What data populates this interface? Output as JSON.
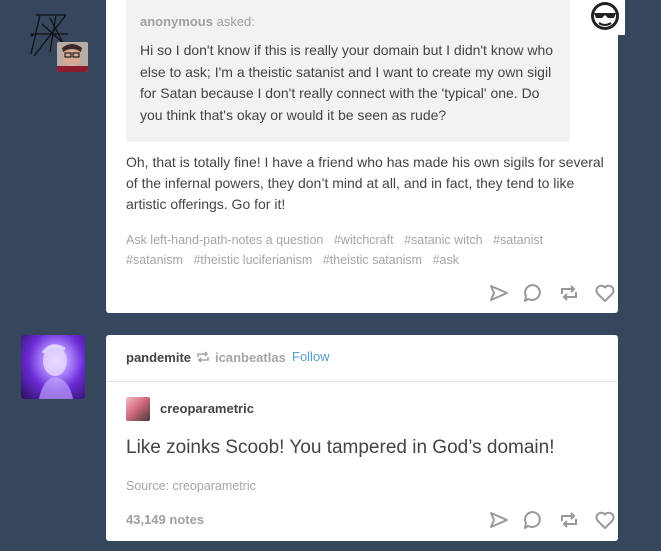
{
  "post1": {
    "asker_name": "anonymous",
    "asked_label": "asked:",
    "question": "Hi so I don't know if this is really your domain but I didn't know who else to ask; I'm a theistic satanist and I want to create my own sigil for Satan because I don't really connect with the 'typical' one. Do you think that's okay or would it be seen as rude?",
    "answer": "Oh, that is totally fine! I have a friend who has made his own sigils for several of the infernal powers, they don’t mind at all, and in fact, they tend to like artistic offerings. Go for it!",
    "tags": [
      "Ask left-hand-path-notes a question",
      "#witchcraft",
      "#satanic witch",
      "#satanist",
      "#satanism",
      "#theistic luciferianism",
      "#theistic satanism",
      "#ask"
    ]
  },
  "post2": {
    "username": "pandemite",
    "reblogged_from": "icanbeatlas",
    "follow_label": "Follow",
    "original_poster": "creoparametric",
    "quote": "Like zoinks Scoob! You tampered in God’s domain!",
    "source": "Source: creoparametric",
    "notes": "43,149 notes"
  },
  "icons": [
    "share-icon",
    "reply-icon",
    "reblog-icon",
    "like-icon"
  ]
}
